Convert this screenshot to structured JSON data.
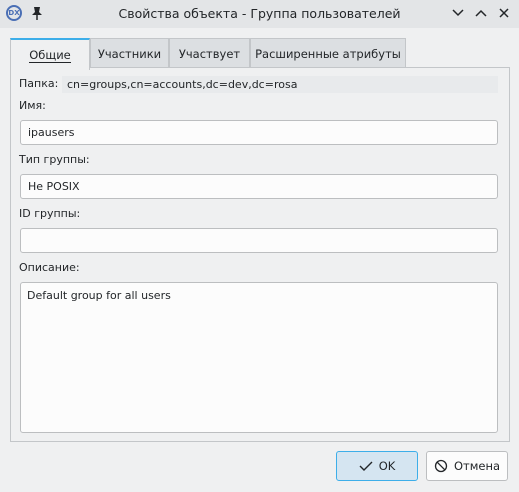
{
  "window": {
    "title": "Свойства объекта - Группа пользователей",
    "app_icon_text": "DX"
  },
  "tabs": [
    {
      "label": "Общие",
      "active": true
    },
    {
      "label": "Участники",
      "active": false
    },
    {
      "label": "Участвует",
      "active": false
    },
    {
      "label": "Расширенные атрибуты",
      "active": false
    }
  ],
  "general": {
    "folder_label": "Папка:",
    "folder_value": "cn=groups,cn=accounts,dc=dev,dc=rosa",
    "name_label": "Имя:",
    "name_value": "ipausers",
    "group_type_label": "Тип группы:",
    "group_type_value": "Не POSIX",
    "group_id_label": "ID группы:",
    "group_id_value": "",
    "description_label": "Описание:",
    "description_value": "Default group for all users"
  },
  "buttons": {
    "ok_label": "OK",
    "cancel_label": "Отмена"
  },
  "icons": {
    "app": "admc-logo-icon",
    "pin": "pin-icon",
    "minimize": "chevron-down-icon",
    "maximize": "chevron-up-icon",
    "close": "close-icon",
    "ok": "check-icon",
    "cancel": "cancel-circle-icon"
  },
  "colors": {
    "accent": "#3daee9",
    "window_bg": "#eff0f1",
    "field_bg": "#fcfcfc"
  }
}
